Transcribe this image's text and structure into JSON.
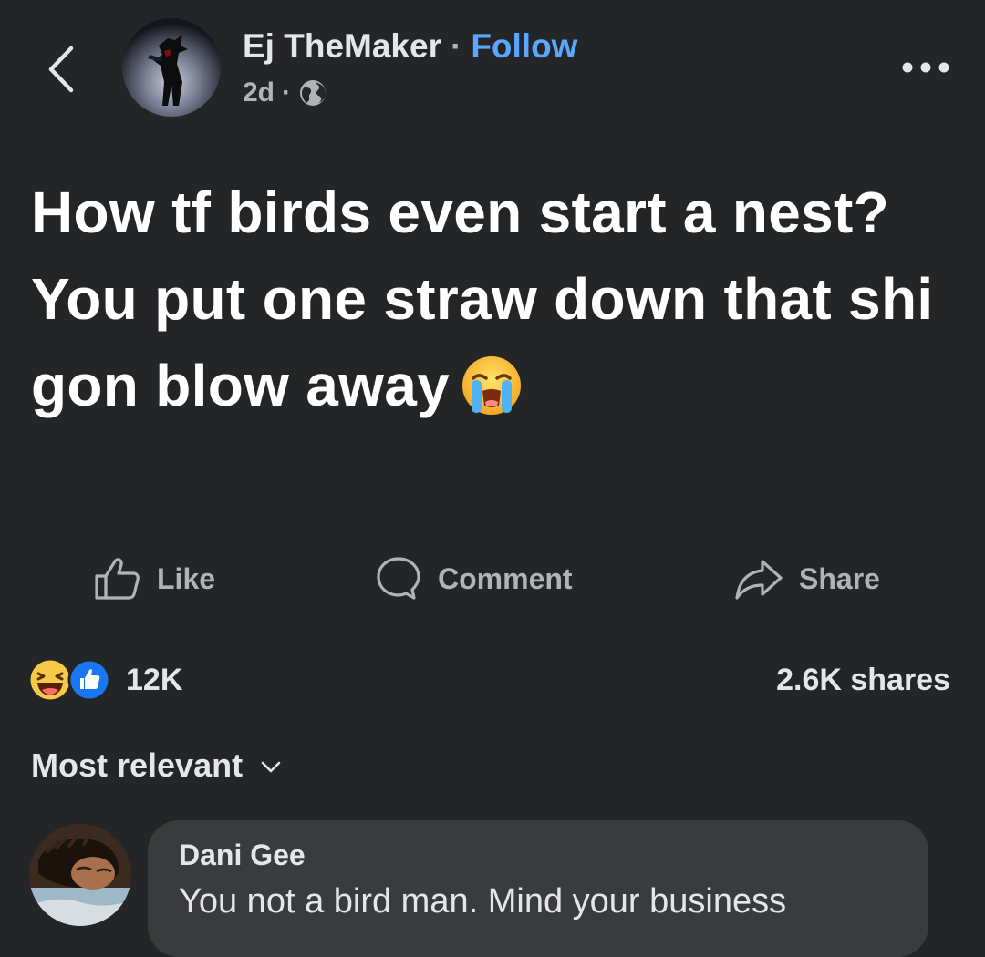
{
  "header": {
    "back_icon": "chevron-left-icon",
    "author_name": "Ej TheMaker",
    "separator": "·",
    "follow_label": "Follow",
    "timestamp": "2d",
    "meta_separator": "·",
    "audience_icon": "globe-icon",
    "more_icon": "more-horizontal-icon"
  },
  "post": {
    "text": "How tf birds even start a nest? You put one straw down that shi gon blow away",
    "emoji": "loudly-crying-face-emoji"
  },
  "actions": {
    "like_label": "Like",
    "comment_label": "Comment",
    "share_label": "Share"
  },
  "stats": {
    "reaction_icons": [
      "haha-reaction-icon",
      "like-reaction-icon"
    ],
    "reaction_count": "12K",
    "shares": "2.6K shares"
  },
  "comments_section": {
    "sort_label": "Most relevant",
    "comments": [
      {
        "author": "Dani Gee",
        "text": "You not a bird man. Mind your business"
      }
    ]
  },
  "colors": {
    "background": "#242526",
    "text_primary": "#e4e6eb",
    "text_secondary": "#b0b3b8",
    "link_blue": "#5aa7ff",
    "comment_bubble": "#3a3b3c"
  }
}
